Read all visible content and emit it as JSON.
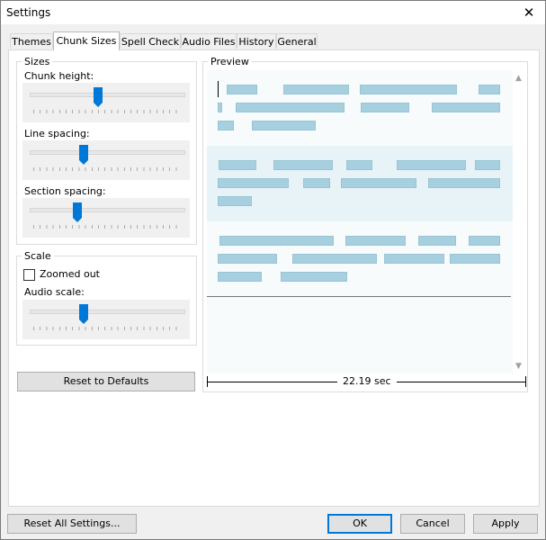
{
  "window": {
    "title": "Settings",
    "close_symbol": "✕"
  },
  "tabs": [
    {
      "label": "Themes",
      "active": false
    },
    {
      "label": "Chunk Sizes",
      "active": true
    },
    {
      "label": "Spell Check",
      "active": false
    },
    {
      "label": "Audio Files",
      "active": false
    },
    {
      "label": "History",
      "active": false
    },
    {
      "label": "General",
      "active": false
    }
  ],
  "sizes": {
    "group_title": "Sizes",
    "chunk_height": {
      "label": "Chunk height:",
      "value": 0.44
    },
    "line_spacing": {
      "label": "Line spacing:",
      "value": 0.34
    },
    "section_spacing": {
      "label": "Section spacing:",
      "value": 0.3
    }
  },
  "scale": {
    "group_title": "Scale",
    "zoomed_out": {
      "label": "Zoomed out",
      "checked": false
    },
    "audio_scale": {
      "label": "Audio scale:",
      "value": 0.34
    }
  },
  "reset_defaults_label": "Reset to Defaults",
  "preview": {
    "group_title": "Preview",
    "duration_label": "22.19 sec",
    "chunk_color": "#a6d0e0",
    "selected_section_color": "#e8f3f8"
  },
  "footer": {
    "reset_all_label": "Reset All Settings...",
    "ok_label": "OK",
    "cancel_label": "Cancel",
    "apply_label": "Apply"
  },
  "accent_color": "#0078d7"
}
